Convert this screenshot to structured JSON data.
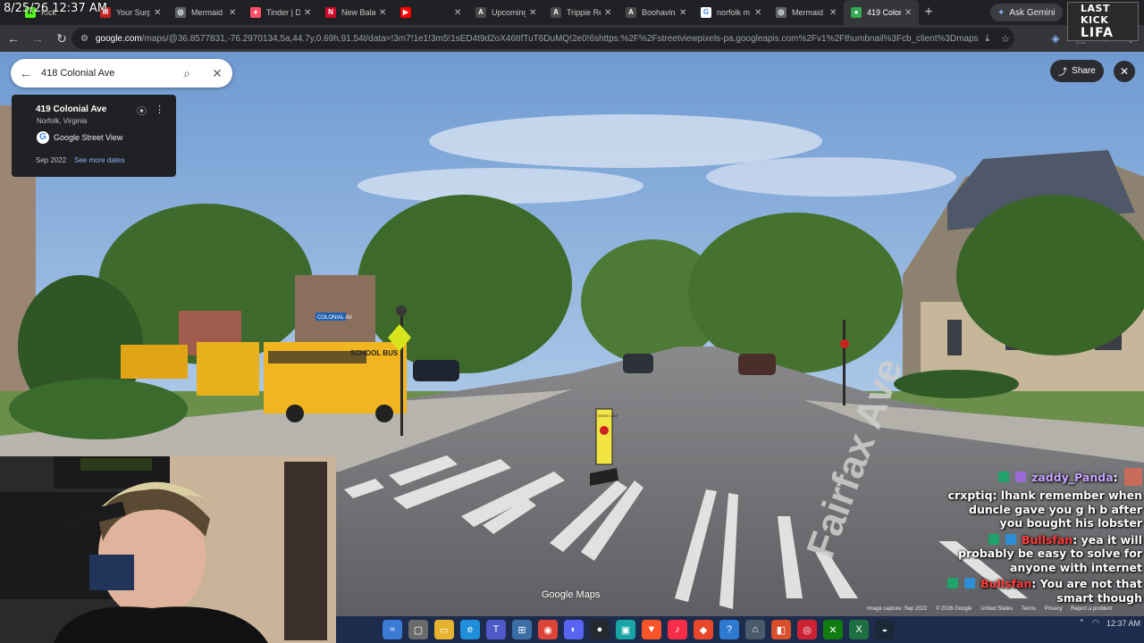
{
  "clock": "8/25/26 12:37 AM",
  "tabs": [
    {
      "label": "Kick",
      "favicon": "kick-icon",
      "color": "#53fc18"
    },
    {
      "label": "Your Surp",
      "favicon": "mail-icon",
      "color": "#c5221f"
    },
    {
      "label": "Mermaid",
      "favicon": "globe-icon",
      "color": "#5f6368"
    },
    {
      "label": "Tinder | Da",
      "favicon": "flame-icon",
      "color": "#fd5068"
    },
    {
      "label": "New Balan",
      "favicon": "nb-icon",
      "color": "#cf0a2c"
    },
    {
      "label": "",
      "favicon": "youtube-icon",
      "color": "#ff0000"
    },
    {
      "label": "Upcoming",
      "favicon": "a-icon",
      "color": "#4a4a4a"
    },
    {
      "label": "Trippie Re",
      "favicon": "a-icon",
      "color": "#4a4a4a"
    },
    {
      "label": "Boohavinn",
      "favicon": "a-icon",
      "color": "#4a4a4a"
    },
    {
      "label": "norfolk m",
      "favicon": "google-icon",
      "color": "#ffffff"
    },
    {
      "label": "Mermaid",
      "favicon": "globe-icon",
      "color": "#5f6368"
    },
    {
      "label": "419 Colon",
      "favicon": "maps-pin-icon",
      "color": "#34a853",
      "active": true
    }
  ],
  "gemini_label": "Ask Gemini",
  "stream_badge": {
    "line1": "LAST KICK",
    "line2": "LIFA"
  },
  "url": {
    "domain": "google.com",
    "rest": "/maps/@36.8577831,-76.2970134,5a,44.7y,0.69h,91.54t/data=!3m7!1e1!3m5!1sED4t9d2oX46tIfTuT6DuMQ!2e0!6shttps:%2F%2Fstreetviewpixels-pa.googleapis.com%2Fv1%2Fthumbnail%3Fcb_client%3Dmaps_sv.tactile%26w%3..."
  },
  "search": {
    "query": "418 Colonial Ave"
  },
  "info_card": {
    "address": "419 Colonial Ave",
    "city": "Norfolk, Virginia",
    "source": "Google Street View",
    "date": "Sep 2022",
    "more_dates": "See more dates"
  },
  "share_label": "Share",
  "maps_logo": "Google Maps",
  "image_capture": [
    "Image capture: Sep 2022",
    "© 2026 Google",
    "United States",
    "Terms",
    "Privacy",
    "Report a problem"
  ],
  "scene_text": {
    "street_sign": "COLONIAL AV",
    "bus_text": "SCHOOL BUS",
    "road_label": "Fairfax Ave",
    "ped_sign": "STATE LAW"
  },
  "chat": [
    {
      "user": "zaddy_Panda",
      "text": "",
      "user_color": "#c9a6ff"
    },
    {
      "user": "crxptiq",
      "text": "lhank remember when duncle gave you g h b after you bought his lobster",
      "user_color": "#ffffff"
    },
    {
      "user": "Bullsfan",
      "text": "yea it will probably be easy to solve for anyone with internet",
      "user_color": "#ff3b3b"
    },
    {
      "user": "Bullsfan",
      "text": "You are not that smart though",
      "user_color": "#ff3b3b"
    }
  ],
  "tray": {
    "time": "12:37 AM"
  },
  "colors": {
    "maps_blue": "#8ab4f8",
    "taskbar": "#1d2c4d",
    "kick_green": "#53fc18"
  }
}
